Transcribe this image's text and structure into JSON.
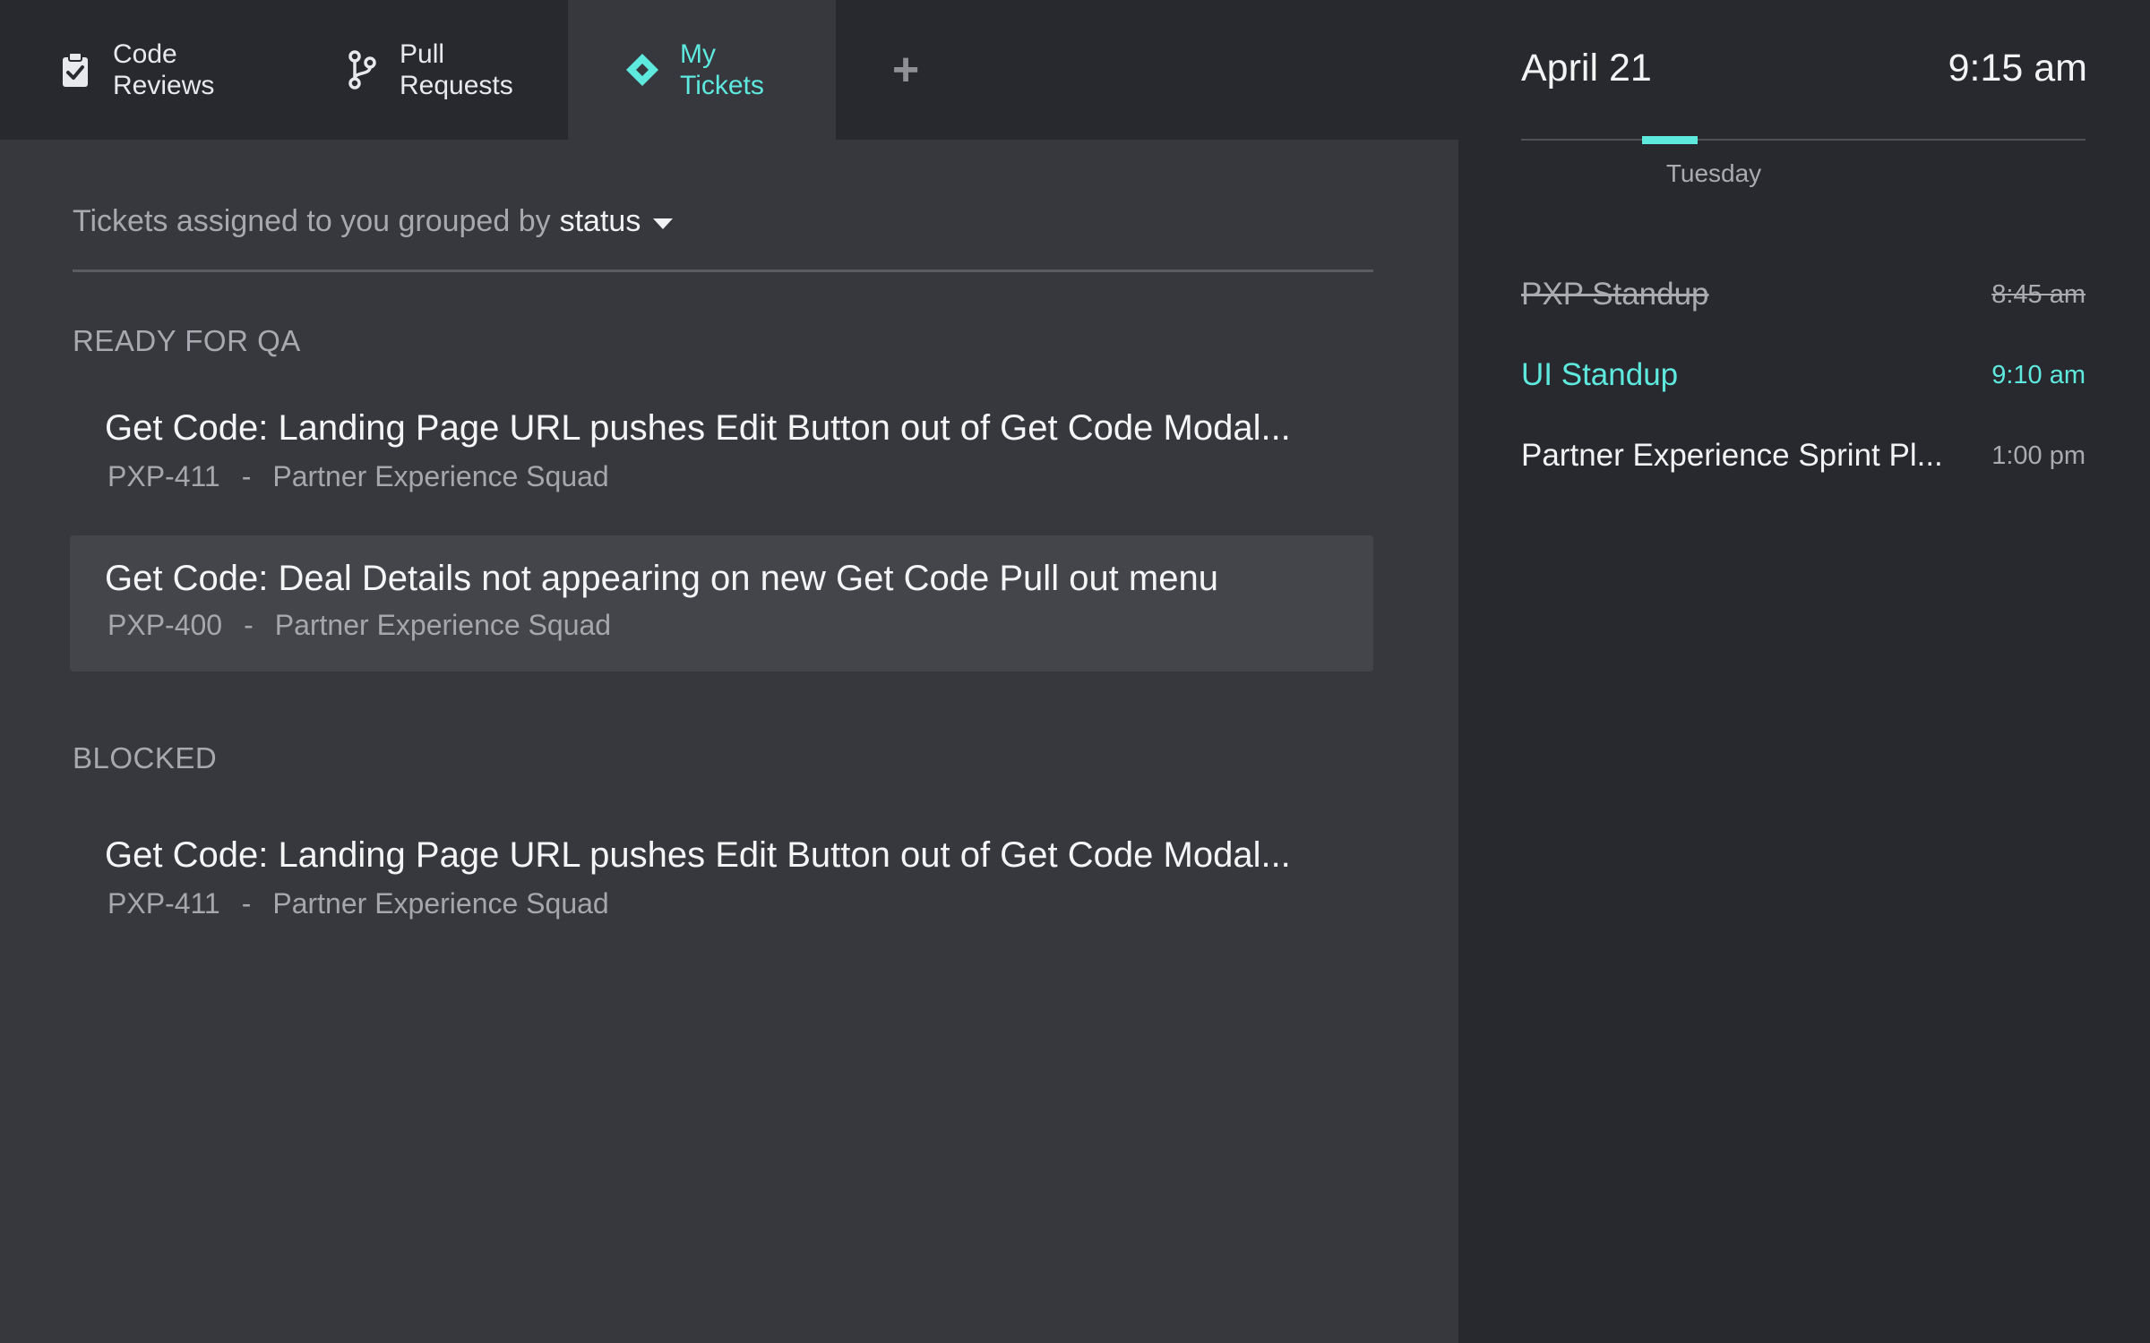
{
  "tabs": [
    {
      "label": "Code Reviews",
      "icon": "clipboard-check-icon",
      "active": false
    },
    {
      "label": "Pull Requests",
      "icon": "git-branch-icon",
      "active": false
    },
    {
      "label": "My Tickets",
      "icon": "diamond-icon",
      "active": true
    }
  ],
  "add_tab": {
    "label": "+",
    "icon": "plus-icon"
  },
  "filter": {
    "prefix": "Tickets assigned to you grouped by",
    "group_by": "status"
  },
  "groups": [
    {
      "heading": "READY FOR QA",
      "tickets": [
        {
          "title": "Get Code: Landing Page URL pushes Edit Button out of Get Code Modal...",
          "key": "PXP-411",
          "separator": "-",
          "squad": "Partner Experience Squad"
        },
        {
          "title": "Get Code: Deal Details not appearing on new Get Code Pull out menu",
          "key": "PXP-400",
          "separator": "-",
          "squad": "Partner Experience Squad"
        }
      ]
    },
    {
      "heading": "BLOCKED",
      "tickets": [
        {
          "title": "Get Code: Landing Page URL pushes Edit Button out of Get Code Modal...",
          "key": "PXP-411",
          "separator": "-",
          "squad": "Partner Experience Squad"
        }
      ]
    }
  ],
  "calendar": {
    "date": "April 21",
    "time": "9:15 am",
    "day": "Tuesday",
    "events": [
      {
        "name": "PXP Standup",
        "time": "8:45 am",
        "status": "past"
      },
      {
        "name": "UI Standup",
        "time": "9:10 am",
        "status": "current"
      },
      {
        "name": "Partner Experience Sprint Pl...",
        "time": "1:00 pm",
        "status": "upcoming"
      }
    ]
  },
  "colors": {
    "accent": "#5ee9df",
    "background_dark": "#28292e",
    "background_panel": "#36383e",
    "row_highlight": "#43454b"
  }
}
